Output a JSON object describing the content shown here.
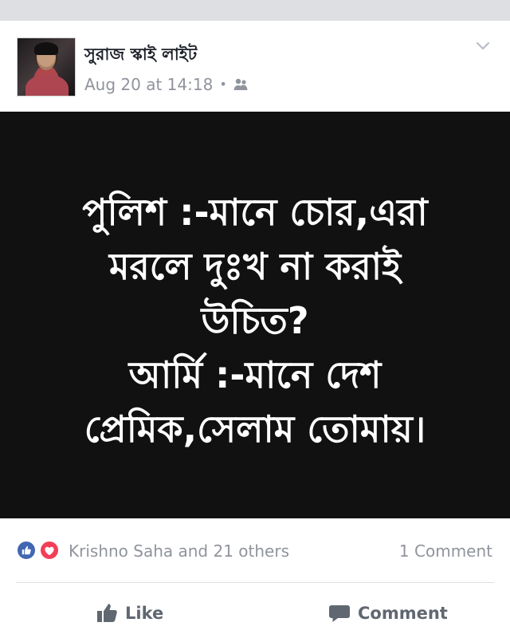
{
  "post": {
    "author_name": "সুরাজ স্কাই লাইট",
    "timestamp": "Aug 20 at 14:18",
    "audience_icon": "friends-icon",
    "menu_icon": "chevron-down-icon"
  },
  "image_text": "পুলিশ :-মানে চোর,এরা\nমরলে দুঃখ না করাই\nউচিত?\nআর্মি :-মানে দেশ\nপ্রেমিক,সেলাম তোমায়।",
  "reactions": {
    "icons": [
      "like-reaction-icon",
      "love-reaction-icon"
    ],
    "liked_by": "Krishno Saha and 21 others",
    "comments_count": "1 Comment"
  },
  "actions": {
    "like_label": "Like",
    "comment_label": "Comment"
  },
  "colors": {
    "text_primary": "#1d2129",
    "text_secondary": "#90949c",
    "like_blue": "#4267b2",
    "love_red": "#f33e58",
    "image_background": "#111111"
  }
}
